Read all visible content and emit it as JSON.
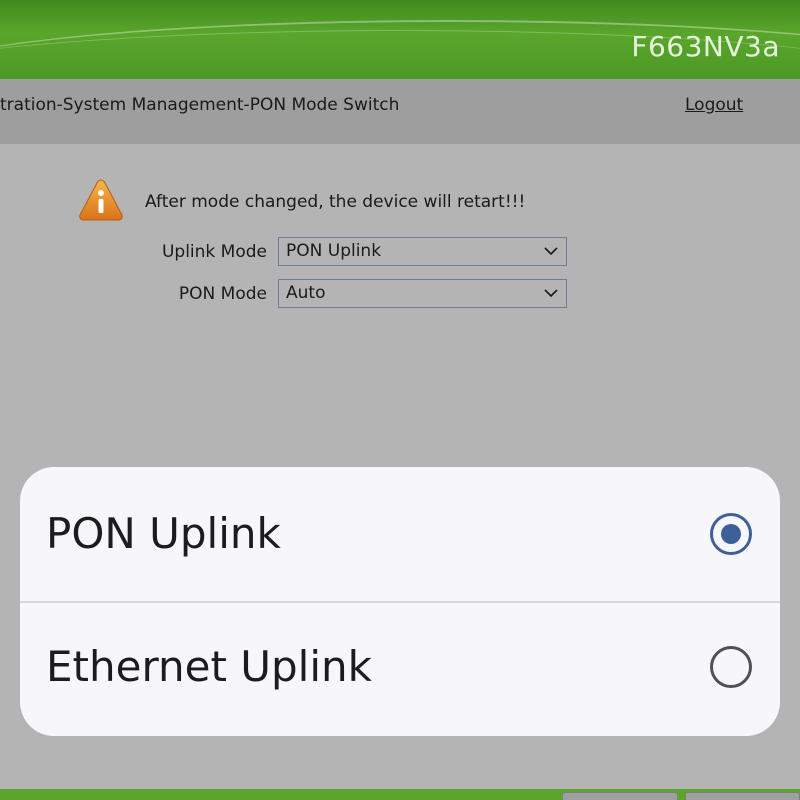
{
  "header": {
    "model": "F663NV3a"
  },
  "breadcrumb": {
    "text": "trtration-System Management-PON Mode Switch",
    "logout": "Logout"
  },
  "notice": {
    "icon": "warning-icon",
    "text": "After mode changed, the device will retart!!!"
  },
  "form": {
    "uplink_label": "Uplink Mode",
    "uplink_value": "PON Uplink",
    "pon_label": "PON Mode",
    "pon_value": "Auto"
  },
  "picker": {
    "options": [
      {
        "label": "PON Uplink",
        "selected": true
      },
      {
        "label": "Ethernet Uplink",
        "selected": false
      }
    ]
  },
  "colors": {
    "brand_green": "#4a9b27",
    "radio_accent": "#3f5f98"
  }
}
